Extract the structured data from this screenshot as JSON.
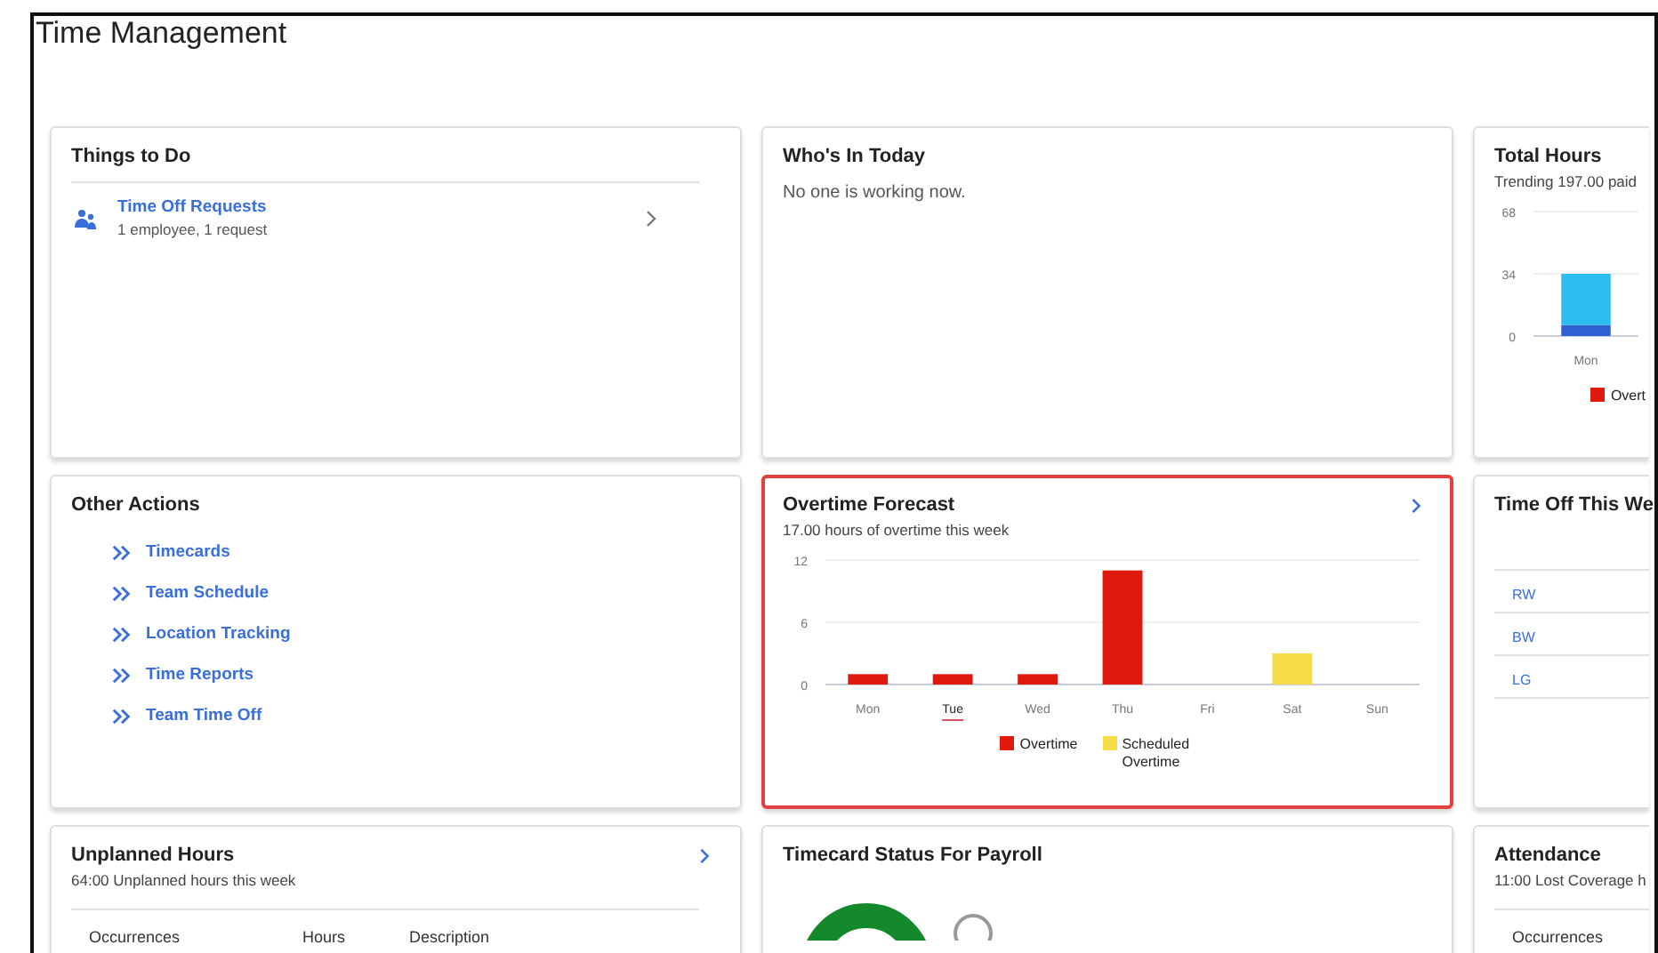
{
  "page": {
    "title": "Time Management"
  },
  "cards": [
    {
      "kind": "todo",
      "title": "Things to Do",
      "items": [
        {
          "title": "Time Off Requests",
          "subtitle": "1 employee, 1 request"
        }
      ]
    },
    {
      "kind": "message",
      "title": "Who's In Today",
      "message": "No one is working now."
    },
    {
      "kind": "chart",
      "title": "Total Hours",
      "subtitle": "Trending 197.00 paid",
      "chart_data": {
        "type": "bar",
        "stacked": true,
        "categories": [
          "Mon"
        ],
        "yticks": [
          0,
          34,
          68
        ],
        "ylim": [
          0,
          68
        ],
        "series": [
          {
            "name": "Overt",
            "color": "#e0190f",
            "values": [
              0
            ]
          },
          {
            "color": "#2f5fd0",
            "values": [
              6
            ]
          },
          {
            "color": "#2bbdf0",
            "values": [
              28
            ]
          }
        ],
        "legend": "bottom"
      }
    },
    {
      "kind": "links",
      "title": "Other Actions",
      "links": [
        "Timecards",
        "Team Schedule",
        "Location Tracking",
        "Time Reports",
        "Team Time Off"
      ]
    },
    {
      "kind": "chart",
      "title": "Overtime Forecast",
      "subtitle": "17.00 hours of overtime this week",
      "has_arrow": true,
      "highlighted": true,
      "chart_data": {
        "type": "bar",
        "stacked": true,
        "categories": [
          "Mon",
          "Tue",
          "Wed",
          "Thu",
          "Fri",
          "Sat",
          "Sun"
        ],
        "yticks": [
          0,
          6,
          12
        ],
        "ylim": [
          0,
          12
        ],
        "series": [
          {
            "name": "Overtime",
            "color": "#e0190f",
            "values": [
              1,
              1,
              1,
              11,
              0,
              0,
              0
            ]
          },
          {
            "name": "Scheduled Overtime",
            "color": "#f7dc4a",
            "values": [
              0,
              0,
              0,
              0,
              0,
              3,
              0
            ]
          }
        ],
        "legend": "bottom",
        "annotations": [
          {
            "x": "Tue"
          }
        ]
      }
    },
    {
      "kind": "table",
      "title": "Time Off This We",
      "rows": [
        "RW",
        "BW",
        "LG"
      ]
    },
    {
      "kind": "table",
      "title": "Unplanned Hours",
      "subtitle": "64:00 Unplanned hours this week",
      "has_arrow": true,
      "columns": [
        "Occurrences",
        "Hours",
        "Description"
      ]
    },
    {
      "kind": "donut",
      "title": "Timecard Status For Payroll"
    },
    {
      "kind": "table",
      "title": "Attendance",
      "subtitle": "11:00 Lost Coverage h",
      "columns": [
        "Occurrences"
      ]
    }
  ]
}
